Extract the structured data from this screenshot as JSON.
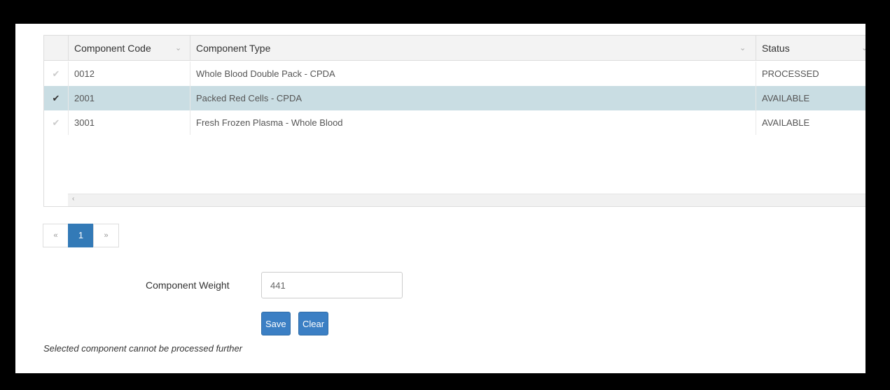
{
  "grid": {
    "columns": [
      {
        "label": "Component Code"
      },
      {
        "label": "Component Type"
      },
      {
        "label": "Status"
      }
    ],
    "rows": [
      {
        "code": "0012",
        "type": "Whole Blood Double Pack - CPDA",
        "status": "PROCESSED",
        "selected": false
      },
      {
        "code": "2001",
        "type": "Packed Red Cells - CPDA",
        "status": "AVAILABLE",
        "selected": true
      },
      {
        "code": "3001",
        "type": "Fresh Frozen Plasma - Whole Blood",
        "status": "AVAILABLE",
        "selected": false
      }
    ]
  },
  "pagination": {
    "first": "«",
    "current": "1",
    "last": "»"
  },
  "form": {
    "weight_label": "Component Weight",
    "weight_value": "441",
    "save_label": "Save",
    "clear_label": "Clear"
  },
  "message": "Selected component cannot be processed further",
  "colors": {
    "accent": "#337ab7",
    "selected_row": "#c9dde3"
  }
}
